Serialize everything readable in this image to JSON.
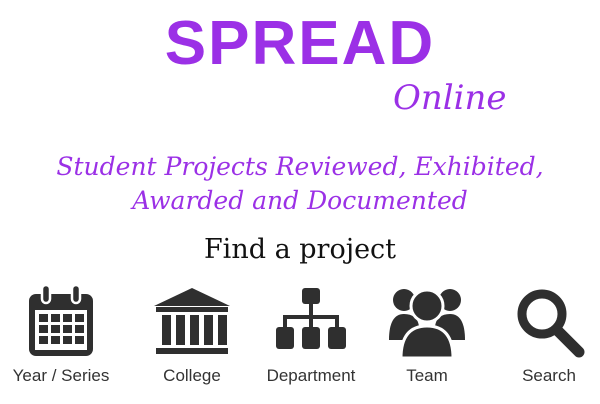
{
  "brand": {
    "title": "SPREAD",
    "subtitle": "Online",
    "color": "#9b30e6"
  },
  "tagline": {
    "line1": "Student Projects Reviewed, Exhibited,",
    "line2": "Awarded and Documented"
  },
  "find_heading": "Find a project",
  "nav": {
    "icon_color": "#2f2f2f",
    "items": [
      {
        "label": "Year / Series",
        "icon": "calendar-icon"
      },
      {
        "label": "College",
        "icon": "building-icon"
      },
      {
        "label": "Department",
        "icon": "org-chart-icon"
      },
      {
        "label": "Team",
        "icon": "team-icon"
      },
      {
        "label": "Search",
        "icon": "search-icon"
      }
    ]
  }
}
